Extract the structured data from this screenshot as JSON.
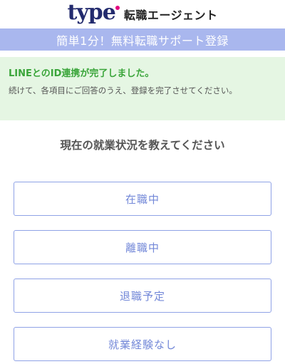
{
  "header": {
    "logo_text": "type",
    "logo_sub": "転職エージェント"
  },
  "banner": {
    "text": "簡単1分！無料転職サポート登録"
  },
  "success": {
    "title": "LINEとのID連携が完了しました。",
    "body": "続けて、各項目にご回答のうえ、登録を完了させてください。"
  },
  "question": {
    "text": "現在の就業状況を教えてください"
  },
  "options": [
    {
      "label": "在職中"
    },
    {
      "label": "離職中"
    },
    {
      "label": "退職予定"
    },
    {
      "label": "就業経験なし"
    }
  ],
  "colors": {
    "brand_navy": "#232b6e",
    "brand_pink": "#e3007f",
    "banner_bg": "#a9b7ee",
    "success_bg": "#e5f6e3",
    "success_text": "#3aa53a",
    "option_border": "#8fa2e6",
    "option_text": "#7388d8"
  }
}
